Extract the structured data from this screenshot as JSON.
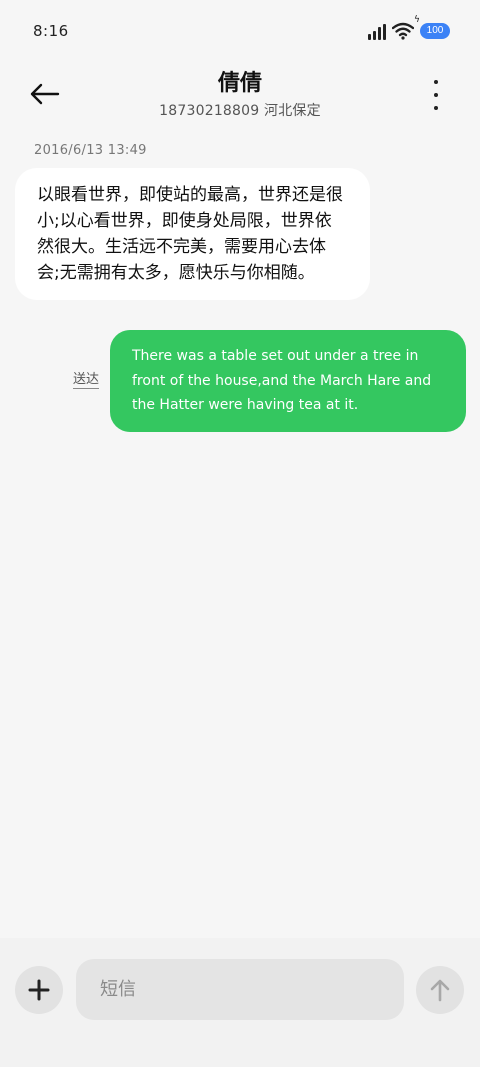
{
  "status_bar": {
    "time": "8:16",
    "battery": "100",
    "icons": [
      "signal-icon",
      "wifi-icon",
      "battery-icon"
    ]
  },
  "header": {
    "contact_name": "倩倩",
    "contact_sub": "18730218809 河北保定",
    "icons": [
      "back-arrow-icon",
      "more-vertical-icon"
    ]
  },
  "conversation": {
    "timestamp": "2016/6/13 13:49",
    "incoming_message": "以眼看世界，即使站的最高，世界还是很小;以心看世界，即使身处局限，世界依然很大。生活远不完美，需要用心去体会;无需拥有太多，愿快乐与你相随。",
    "outgoing_message": "There was a table set out under a tree in front of the house,and the March Hare and the Hatter were having tea at it.",
    "sent_status": "送达"
  },
  "input_bar": {
    "placeholder": "短信",
    "icons": [
      "plus-icon",
      "send-arrow-icon"
    ]
  },
  "colors": {
    "background": "#f6f6f6",
    "incoming_bubble": "#ffffff",
    "outgoing_bubble": "#34c760",
    "battery": "#3b82f6"
  }
}
